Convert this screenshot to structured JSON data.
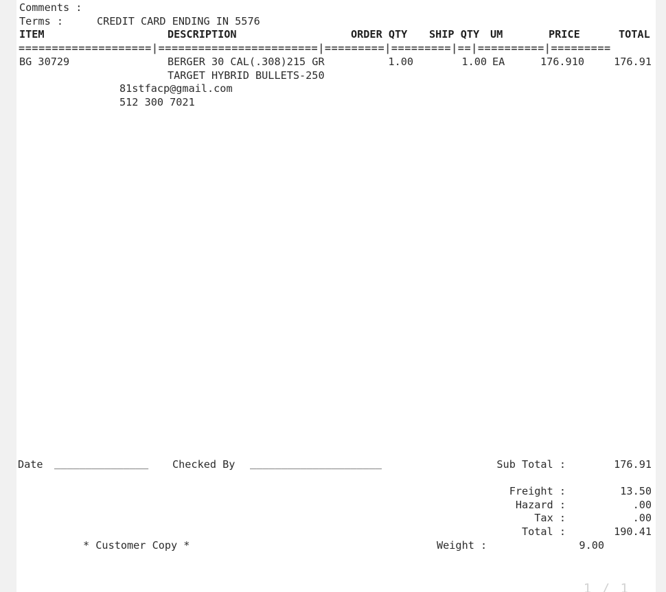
{
  "document": {
    "type": "purchase-order-customer-copy",
    "comments_label": "Comments :",
    "comments_value": "",
    "terms_label": "Terms :",
    "terms_value": "CREDIT CARD ENDING IN 5576",
    "columns": {
      "item": "ITEM",
      "description": "DESCRIPTION",
      "order_qty": "ORDER QTY",
      "ship_qty": "SHIP QTY",
      "um": "UM",
      "price": "PRICE",
      "total": "TOTAL"
    },
    "separator": "====================|========================|=========|=========|==|==========|=========",
    "line_items": [
      {
        "item": "BG 30729",
        "description_line_1": "BERGER 30 CAL(.308)215 GR",
        "description_line_2": "TARGET HYBRID BULLETS-250",
        "order_qty": "1.00",
        "ship_qty": "1.00",
        "um": "EA",
        "price": "176.910",
        "total": "176.91"
      }
    ],
    "contact": {
      "email": "81stfacp@gmail.com",
      "phone": "512 300 7021"
    },
    "signature": {
      "date_label": "Date",
      "date_rule": "_______________",
      "checked_by_label": "Checked By",
      "checked_by_rule": "_____________________"
    },
    "totals": [
      {
        "label": "Sub Total :",
        "value": "176.91"
      },
      {
        "label": "Freight :",
        "value": "13.50"
      },
      {
        "label": "Hazard :",
        "value": ".00"
      },
      {
        "label": "Tax :",
        "value": ".00"
      },
      {
        "label": "Total :",
        "value": "190.41"
      }
    ],
    "weight_label": "Weight :",
    "weight_value": "9.00",
    "copy_notice": "* Customer Copy *",
    "page_indicator": "1 / 1"
  },
  "colors": {
    "page_background": "#ffffff",
    "gutter": "#f1f1f1",
    "text": "#2b2b2b",
    "separator": "#4a4a4a",
    "page_indicator": "#d2d2d2"
  }
}
